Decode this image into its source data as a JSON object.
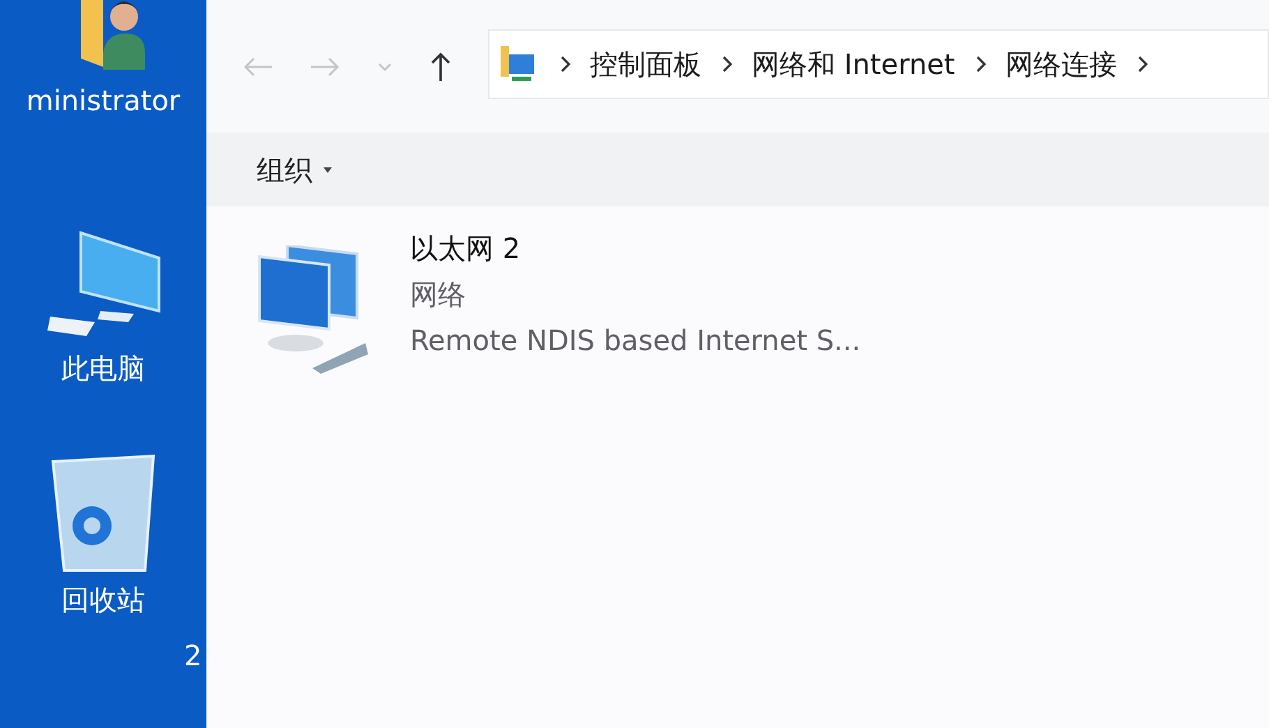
{
  "desktop": {
    "icons": [
      {
        "kind": "user",
        "label": "ministrator"
      },
      {
        "kind": "computer",
        "label": "此电脑"
      },
      {
        "kind": "recycle",
        "label": "回收站"
      }
    ],
    "edge_text": "2"
  },
  "address_bar": {
    "crumbs": [
      "控制面板",
      "网络和 Internet",
      "网络连接"
    ]
  },
  "toolbar": {
    "organize": "组织"
  },
  "connections": [
    {
      "name": "以太网 2",
      "status": "网络",
      "device": "Remote NDIS based Internet S..."
    }
  ]
}
